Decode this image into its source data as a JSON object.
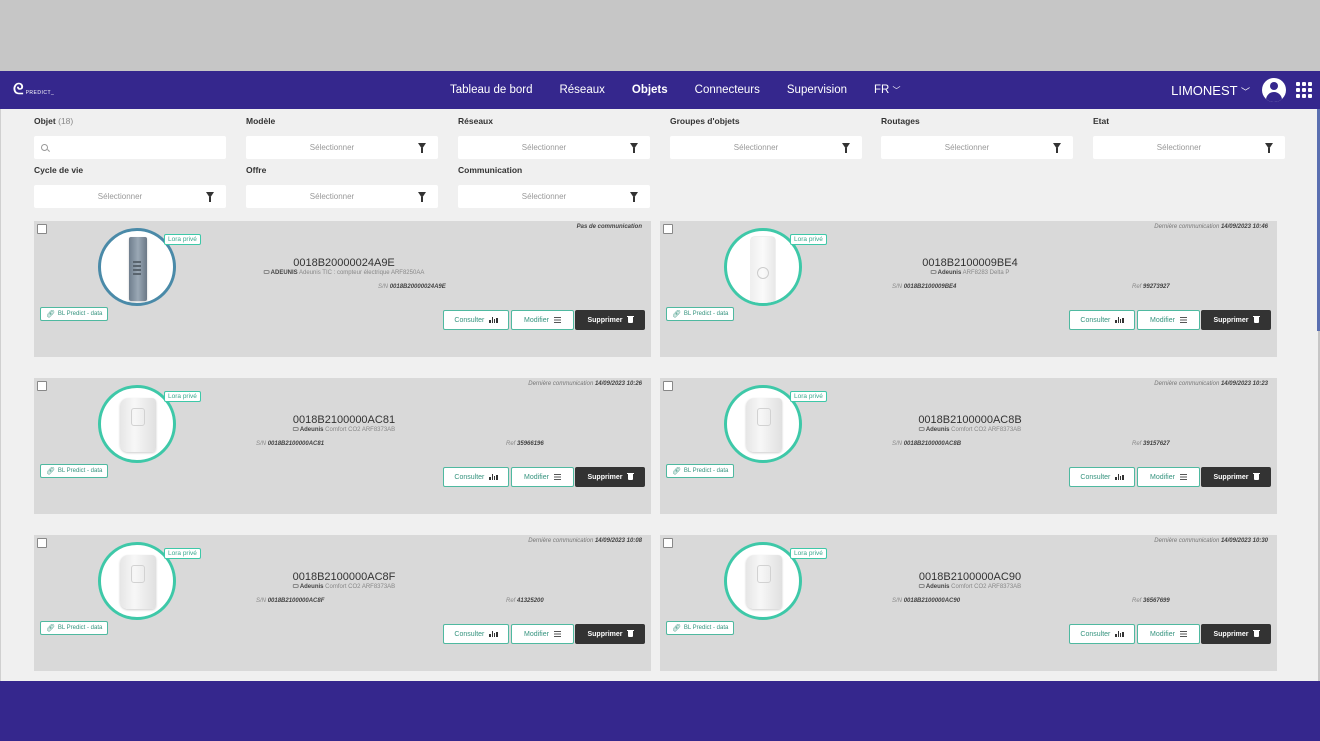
{
  "app": {
    "logo_text": "PREDICT_",
    "site_name": "LIMONEST"
  },
  "nav": {
    "items": [
      "Tableau de bord",
      "Réseaux",
      "Objets",
      "Connecteurs",
      "Supervision",
      "FR"
    ],
    "active": "Objets"
  },
  "filters": {
    "objet": {
      "label": "Objet",
      "count": "(18)"
    },
    "modele": {
      "label": "Modèle",
      "placeholder": "Sélectionner"
    },
    "reseaux": {
      "label": "Réseaux",
      "placeholder": "Sélectionner"
    },
    "groupes": {
      "label": "Groupes d'objets",
      "placeholder": "Sélectionner"
    },
    "routages": {
      "label": "Routages",
      "placeholder": "Sélectionner"
    },
    "etat": {
      "label": "Etat",
      "placeholder": "Sélectionner"
    },
    "cycle": {
      "label": "Cycle de vie",
      "placeholder": "Sélectionner"
    },
    "offre": {
      "label": "Offre",
      "placeholder": "Sélectionner"
    },
    "communication": {
      "label": "Communication",
      "placeholder": "Sélectionner"
    }
  },
  "common": {
    "badge": "Lora privé",
    "bl_tag": "BL Predict - data",
    "consult": "Consulter",
    "modify": "Modifier",
    "delete": "Supprimer",
    "last_comm_label": "Dernière communication",
    "sn_label": "S/N",
    "ref_label": "Ref",
    "brand_color": "#35278d",
    "accent_color": "#3ec8a8"
  },
  "devices": [
    {
      "name": "0018B20000024A9E",
      "brand": "ADEUNIS",
      "model": "Adeunis TIC : compteur électrique ARF8250AA",
      "sn": "0018B20000024A9E",
      "ref": "",
      "comm_date": "",
      "comm_none": "Pas de communication",
      "image": "metal-device"
    },
    {
      "name": "0018B2100009BE4",
      "brand": "Adeunis",
      "model": "ARF8283 Delta P",
      "sn": "0018B2100009BE4",
      "ref": "99273927",
      "comm_date": "14/09/2023 10:46",
      "comm_none": "",
      "image": "slim-device"
    },
    {
      "name": "0018B2100000AC81",
      "brand": "Adeunis",
      "model": "Comfort CO2 ARF8373AB",
      "sn": "0018B2100000AC81",
      "ref": "35966196",
      "comm_date": "14/09/2023 10:26",
      "comm_none": "",
      "image": "sensor-device"
    },
    {
      "name": "0018B2100000AC8B",
      "brand": "Adeunis",
      "model": "Comfort CO2 ARF8373AB",
      "sn": "0018B2100000AC8B",
      "ref": "39157627",
      "comm_date": "14/09/2023 10:23",
      "comm_none": "",
      "image": "sensor-device"
    },
    {
      "name": "0018B2100000AC8F",
      "brand": "Adeunis",
      "model": "Comfort CO2 ARF8373AB",
      "sn": "0018B2100000AC8F",
      "ref": "41325200",
      "comm_date": "14/09/2023 10:08",
      "comm_none": "",
      "image": "sensor-device"
    },
    {
      "name": "0018B2100000AC90",
      "brand": "Adeunis",
      "model": "Comfort CO2 ARF8373AB",
      "sn": "0018B2100000AC90",
      "ref": "36567699",
      "comm_date": "14/09/2023 10:30",
      "comm_none": "",
      "image": "sensor-device"
    }
  ]
}
